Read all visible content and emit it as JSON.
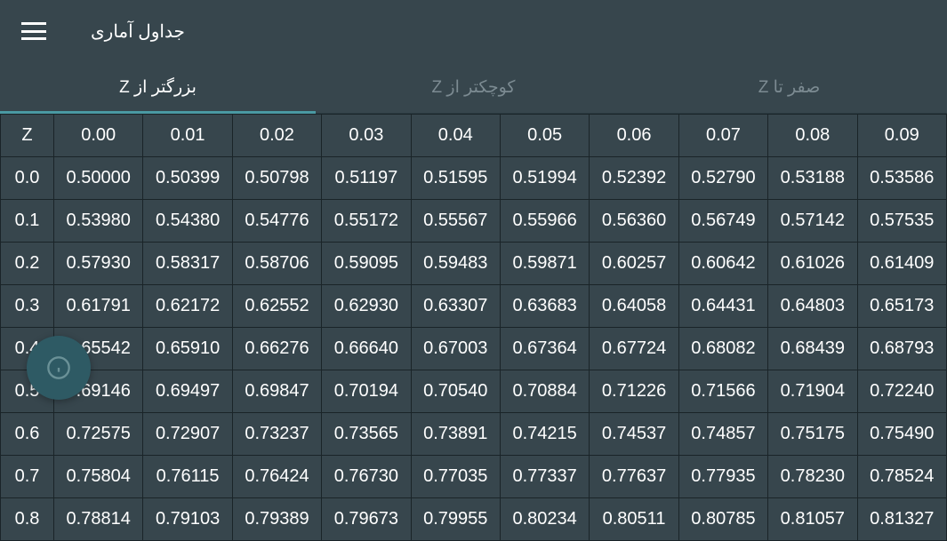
{
  "header": {
    "title": "جداول آماری"
  },
  "tabs": [
    {
      "label": "بزرگتر از Z",
      "active": true
    },
    {
      "label": "کوچکتر از Z",
      "active": false
    },
    {
      "label": "صفر تا Z",
      "active": false
    }
  ],
  "table": {
    "headers": [
      "Z",
      "0.00",
      "0.01",
      "0.02",
      "0.03",
      "0.04",
      "0.05",
      "0.06",
      "0.07",
      "0.08",
      "0.09"
    ],
    "rows": [
      {
        "z": "0.0",
        "values": [
          "0.50000",
          "0.50399",
          "0.50798",
          "0.51197",
          "0.51595",
          "0.51994",
          "0.52392",
          "0.52790",
          "0.53188",
          "0.53586"
        ]
      },
      {
        "z": "0.1",
        "values": [
          "0.53980",
          "0.54380",
          "0.54776",
          "0.55172",
          "0.55567",
          "0.55966",
          "0.56360",
          "0.56749",
          "0.57142",
          "0.57535"
        ]
      },
      {
        "z": "0.2",
        "values": [
          "0.57930",
          "0.58317",
          "0.58706",
          "0.59095",
          "0.59483",
          "0.59871",
          "0.60257",
          "0.60642",
          "0.61026",
          "0.61409"
        ]
      },
      {
        "z": "0.3",
        "values": [
          "0.61791",
          "0.62172",
          "0.62552",
          "0.62930",
          "0.63307",
          "0.63683",
          "0.64058",
          "0.64431",
          "0.64803",
          "0.65173"
        ]
      },
      {
        "z": "0.4",
        "values": [
          "0.65542",
          "0.65910",
          "0.66276",
          "0.66640",
          "0.67003",
          "0.67364",
          "0.67724",
          "0.68082",
          "0.68439",
          "0.68793"
        ]
      },
      {
        "z": "0.5",
        "values": [
          "0.69146",
          "0.69497",
          "0.69847",
          "0.70194",
          "0.70540",
          "0.70884",
          "0.71226",
          "0.71566",
          "0.71904",
          "0.72240"
        ]
      },
      {
        "z": "0.6",
        "values": [
          "0.72575",
          "0.72907",
          "0.73237",
          "0.73565",
          "0.73891",
          "0.74215",
          "0.74537",
          "0.74857",
          "0.75175",
          "0.75490"
        ]
      },
      {
        "z": "0.7",
        "values": [
          "0.75804",
          "0.76115",
          "0.76424",
          "0.76730",
          "0.77035",
          "0.77337",
          "0.77637",
          "0.77935",
          "0.78230",
          "0.78524"
        ]
      },
      {
        "z": "0.8",
        "values": [
          "0.78814",
          "0.79103",
          "0.79389",
          "0.79673",
          "0.79955",
          "0.80234",
          "0.80511",
          "0.80785",
          "0.81057",
          "0.81327"
        ]
      }
    ]
  }
}
